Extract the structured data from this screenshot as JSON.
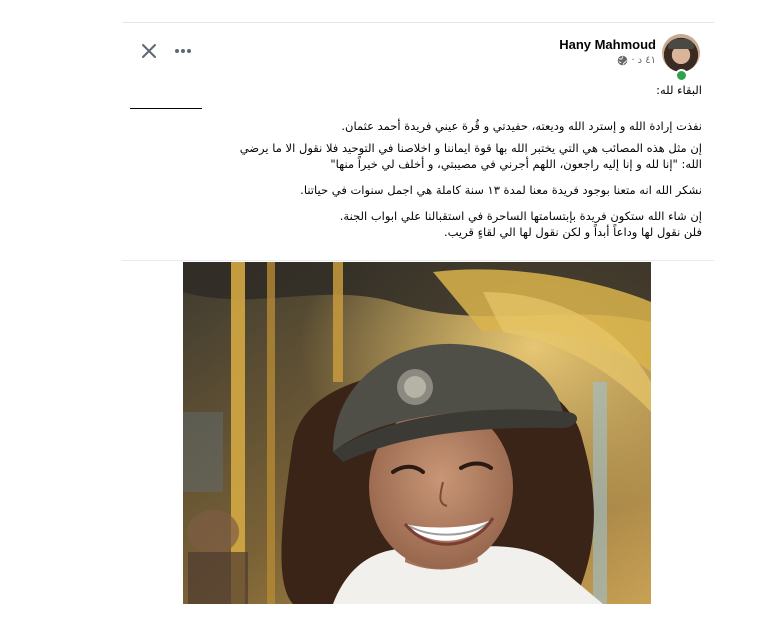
{
  "post": {
    "author": "Hany Mahmoud",
    "time": "٤١ د",
    "privacy_icon": "globe-icon",
    "author_online": true,
    "actions": {
      "more_icon": "more-horizontal-icon",
      "close_icon": "close-icon"
    },
    "text": {
      "greeting": "البقاء لله:",
      "paragraph1": "نفذت إرادة الله و إسترد الله وديعته، حفيدتي و قُرة عيني فريدة أحمد عثمان.",
      "paragraph2_line1": "إن مثل هذه المصائب هي التي يختبر الله بها قوة ايماننا و اخلاصنا في التوحيد فلا نقول الا ما يرضي",
      "paragraph2_line2": "الله: \"إنا لله و إنا إليه راجعون، اللهم أجرني في مصيبتي، و أخلف لي خيراً منها\"",
      "paragraph3": "نشكر الله انه متعنا  بوجود فريدة معنا لمدة ١٣ سنة كاملة هي اجمل سنوات في حياتنا.",
      "paragraph4_line1": "إن شاء الله ستكون فريدة بإبتسامتها الساحرة في استقبالنا علي ابواب الجنة.",
      "paragraph4_line2": "فلن نقول لها وداعاً أبداً  و لكن نقول لها الي لقاءٍ قريب."
    },
    "photo": {
      "subject": "smiling girl wearing a cap in front of a carousel",
      "colors": {
        "carousel_gold": "#d8b04a",
        "cap": "#4f4e47",
        "hair": "#3a2418",
        "skin": "#b9876a",
        "shirt": "#f2f0ec"
      }
    }
  },
  "colors": {
    "text_primary": "#050505",
    "text_secondary": "#65676b",
    "online": "#31a24c",
    "divider": "#e4e6eb"
  }
}
